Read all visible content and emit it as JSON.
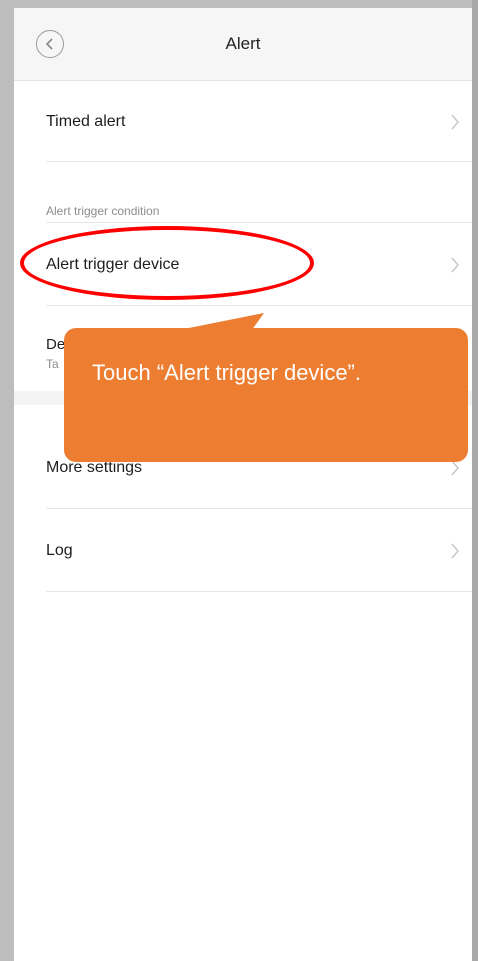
{
  "header": {
    "title": "Alert"
  },
  "rows": {
    "timed_alert": "Timed alert",
    "section_label": "Alert trigger condition",
    "trigger_device": "Alert trigger device",
    "partial_title": "De",
    "partial_sub": "Ta",
    "more_settings": "More settings",
    "log": "Log"
  },
  "tooltip": {
    "text": "Touch “Alert trigger device”."
  },
  "colors": {
    "tooltip_bg": "#ed7d31",
    "highlight": "#ff0000",
    "background": "#ffffff"
  },
  "icons": {
    "back": "back-arrow-icon",
    "chevron": "chevron-right-icon"
  }
}
